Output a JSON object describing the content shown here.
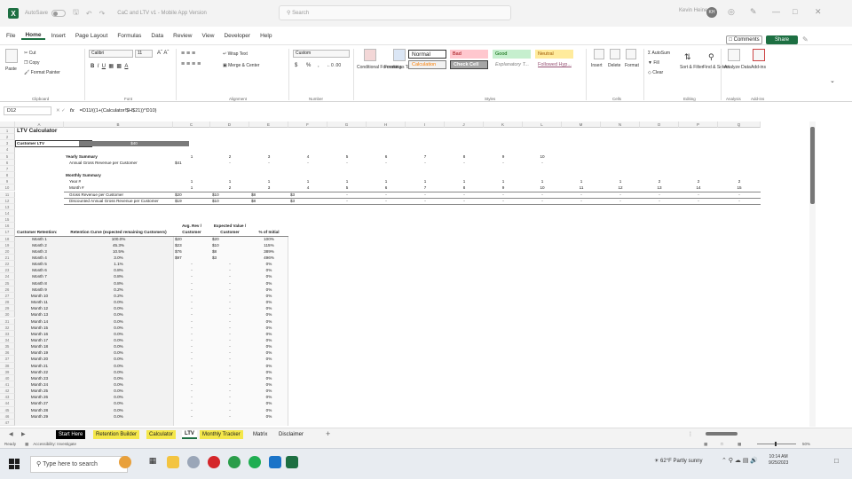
{
  "window": {
    "autosave_label": "AutoSave",
    "autosave_state": "Off",
    "title": "CaC and LTV v1 - Mobile App Version",
    "search_placeholder": "Search",
    "user_name": "Kevin Heine",
    "avatar_initials": "KH"
  },
  "menu": [
    "File",
    "Home",
    "Insert",
    "Page Layout",
    "Formulas",
    "Data",
    "Review",
    "View",
    "Developer",
    "Help"
  ],
  "menu_active": "Home",
  "buttons": {
    "comments": "Comments",
    "share": "Share"
  },
  "ribbon": {
    "paste": "Paste",
    "cut": "Cut",
    "copy": "Copy",
    "format_painter": "Format Painter",
    "font_name": "Calibri",
    "font_size": "11",
    "wrap_text": "Wrap Text",
    "merge_center": "Merge & Center",
    "number_format": "Custom",
    "currency_symbol": "$",
    "percent_symbol": "%",
    "comma_symbol": ",",
    "conditional_formatting": "Conditional Formatting",
    "format_as_table": "Format as Table",
    "styles": {
      "normal": "Normal",
      "bad": "Bad",
      "good": "Good",
      "neutral": "Neutral",
      "calculation": "Calculation",
      "check_cell": "Check Cell",
      "explanatory": "Explanatory T...",
      "followed_hyperlink": "Followed Hyp..."
    },
    "insert": "Insert",
    "delete": "Delete",
    "format": "Format",
    "autosum": "AutoSum",
    "fill": "Fill",
    "clear": "Clear",
    "sort_filter": "Sort & Filter",
    "find_select": "Find & Select",
    "analyze_data": "Analyze Data",
    "addins": "Add-ins",
    "groups": {
      "clipboard": "Clipboard",
      "font": "Font",
      "alignment": "Alignment",
      "number": "Number",
      "styles": "Styles",
      "cells": "Cells",
      "editing": "Editing",
      "analysis": "Analysis",
      "addins": "Add-ins"
    }
  },
  "formula_bar": {
    "name_box": "D12",
    "formula": "=D11/((1+(Calculator!$H$21))^D10)"
  },
  "columns": [
    "A",
    "B",
    "C",
    "D",
    "E",
    "F",
    "G",
    "H",
    "I",
    "J",
    "K",
    "L",
    "M",
    "N",
    "O",
    "P",
    "Q"
  ],
  "sheet": {
    "title": "LTV Calculator",
    "customer_ltv_label": "Customer LTV",
    "customer_ltv_value": "$40",
    "yearly_summary": "Yearly Summary",
    "annual_gross_label": "Annual Gross Revenue per Customer",
    "yearly_headers": [
      "1",
      "2",
      "3",
      "4",
      "5",
      "6",
      "7",
      "8",
      "9",
      "10"
    ],
    "yearly_values": [
      "$41",
      "-",
      "-",
      "-",
      "-",
      "-",
      "-",
      "-",
      "-",
      "-"
    ],
    "monthly_summary": "Monthly Summary",
    "year_label": "Year #",
    "month_label": "Month #",
    "year_values": [
      "1",
      "1",
      "1",
      "1",
      "1",
      "1",
      "1",
      "1",
      "1",
      "1",
      "1",
      "1",
      "2",
      "2",
      "2"
    ],
    "month_values": [
      "1",
      "2",
      "3",
      "4",
      "5",
      "6",
      "7",
      "8",
      "9",
      "10",
      "11",
      "12",
      "13",
      "14",
      "15"
    ],
    "gross_rev_label": "Gross Revenue per Customer",
    "gross_rev_values": [
      "$20",
      "$10",
      "$8",
      "$3",
      "-",
      "-",
      "-",
      "-",
      "-",
      "-",
      "-",
      "-",
      "-",
      "-",
      "-"
    ],
    "disc_label": "Discounted Annual Gross Revenue per Customer",
    "disc_values": [
      "$19",
      "$10",
      "$8",
      "$3",
      "-",
      "-",
      "-",
      "-",
      "-",
      "-",
      "-",
      "-",
      "-",
      "-",
      "-"
    ],
    "table_headers": {
      "retention": "Customer Retention:",
      "curve": "Retention Curve (expected remaining Customers)",
      "avg_rev_1": "Avg. Rev /",
      "avg_rev_2": "Customer",
      "exp_val_1": "Expected Value /",
      "exp_val_2": "Customer",
      "pct": "% of Initial"
    },
    "rows": [
      {
        "m": "Month 1",
        "curve": "100.0%",
        "avg": "$20",
        "exp": "$20",
        "pct": "100%"
      },
      {
        "m": "Month 2",
        "curve": "45.3%",
        "avg": "$23",
        "exp": "$10",
        "pct": "115%"
      },
      {
        "m": "Month 3",
        "curve": "10.5%",
        "avg": "$76",
        "exp": "$8",
        "pct": "389%"
      },
      {
        "m": "Month 4",
        "curve": "3.0%",
        "avg": "$97",
        "exp": "$3",
        "pct": "496%"
      },
      {
        "m": "Month 5",
        "curve": "1.1%",
        "avg": "-",
        "exp": "-",
        "pct": "0%"
      },
      {
        "m": "Month 6",
        "curve": "0.8%",
        "avg": "-",
        "exp": "-",
        "pct": "0%"
      },
      {
        "m": "Month 7",
        "curve": "0.8%",
        "avg": "-",
        "exp": "-",
        "pct": "0%"
      },
      {
        "m": "Month 8",
        "curve": "0.8%",
        "avg": "-",
        "exp": "-",
        "pct": "0%"
      },
      {
        "m": "Month 9",
        "curve": "0.2%",
        "avg": "-",
        "exp": "-",
        "pct": "0%"
      },
      {
        "m": "Month 10",
        "curve": "0.2%",
        "avg": "-",
        "exp": "-",
        "pct": "0%"
      },
      {
        "m": "Month 11",
        "curve": "0.0%",
        "avg": "-",
        "exp": "-",
        "pct": "0%"
      },
      {
        "m": "Month 12",
        "curve": "0.0%",
        "avg": "-",
        "exp": "-",
        "pct": "0%"
      },
      {
        "m": "Month 13",
        "curve": "0.0%",
        "avg": "-",
        "exp": "-",
        "pct": "0%"
      },
      {
        "m": "Month 14",
        "curve": "0.0%",
        "avg": "-",
        "exp": "-",
        "pct": "0%"
      },
      {
        "m": "Month 15",
        "curve": "0.0%",
        "avg": "-",
        "exp": "-",
        "pct": "0%"
      },
      {
        "m": "Month 16",
        "curve": "0.0%",
        "avg": "-",
        "exp": "-",
        "pct": "0%"
      },
      {
        "m": "Month 17",
        "curve": "0.0%",
        "avg": "-",
        "exp": "-",
        "pct": "0%"
      },
      {
        "m": "Month 18",
        "curve": "0.0%",
        "avg": "-",
        "exp": "-",
        "pct": "0%"
      },
      {
        "m": "Month 19",
        "curve": "0.0%",
        "avg": "-",
        "exp": "-",
        "pct": "0%"
      },
      {
        "m": "Month 20",
        "curve": "0.0%",
        "avg": "-",
        "exp": "-",
        "pct": "0%"
      },
      {
        "m": "Month 21",
        "curve": "0.0%",
        "avg": "-",
        "exp": "-",
        "pct": "0%"
      },
      {
        "m": "Month 22",
        "curve": "0.0%",
        "avg": "-",
        "exp": "-",
        "pct": "0%"
      },
      {
        "m": "Month 23",
        "curve": "0.0%",
        "avg": "-",
        "exp": "-",
        "pct": "0%"
      },
      {
        "m": "Month 24",
        "curve": "0.0%",
        "avg": "-",
        "exp": "-",
        "pct": "0%"
      },
      {
        "m": "Month 25",
        "curve": "0.0%",
        "avg": "-",
        "exp": "-",
        "pct": "0%"
      },
      {
        "m": "Month 26",
        "curve": "0.0%",
        "avg": "-",
        "exp": "-",
        "pct": "0%"
      },
      {
        "m": "Month 27",
        "curve": "0.0%",
        "avg": "-",
        "exp": "-",
        "pct": "0%"
      },
      {
        "m": "Month 28",
        "curve": "0.0%",
        "avg": "-",
        "exp": "-",
        "pct": "0%"
      },
      {
        "m": "Month 29",
        "curve": "0.0%",
        "avg": "-",
        "exp": "-",
        "pct": "0%"
      }
    ]
  },
  "sheet_tabs": [
    "Start Here",
    "Retention Builder",
    "Calculator",
    "LTV",
    "Monthly Tracker",
    "Matrix",
    "Disclaimer"
  ],
  "sheet_tab_active": "LTV",
  "status": {
    "ready": "Ready",
    "accessibility": "Accessibility: Investigate",
    "zoom": "50%"
  },
  "taskbar": {
    "search_placeholder": "Type here to search",
    "weather": "62°F Partly sunny",
    "time": "10:14 AM",
    "date": "9/25/2023"
  },
  "colors": {
    "excel_green": "#1d6f42",
    "tab_yellow": "#f4e74a",
    "bad_bg": "#ffc7ce",
    "good_bg": "#c6efce",
    "neutral_bg": "#ffeb9c",
    "calc_bg": "#f2f2f2",
    "check_bg": "#a5a5a5"
  }
}
